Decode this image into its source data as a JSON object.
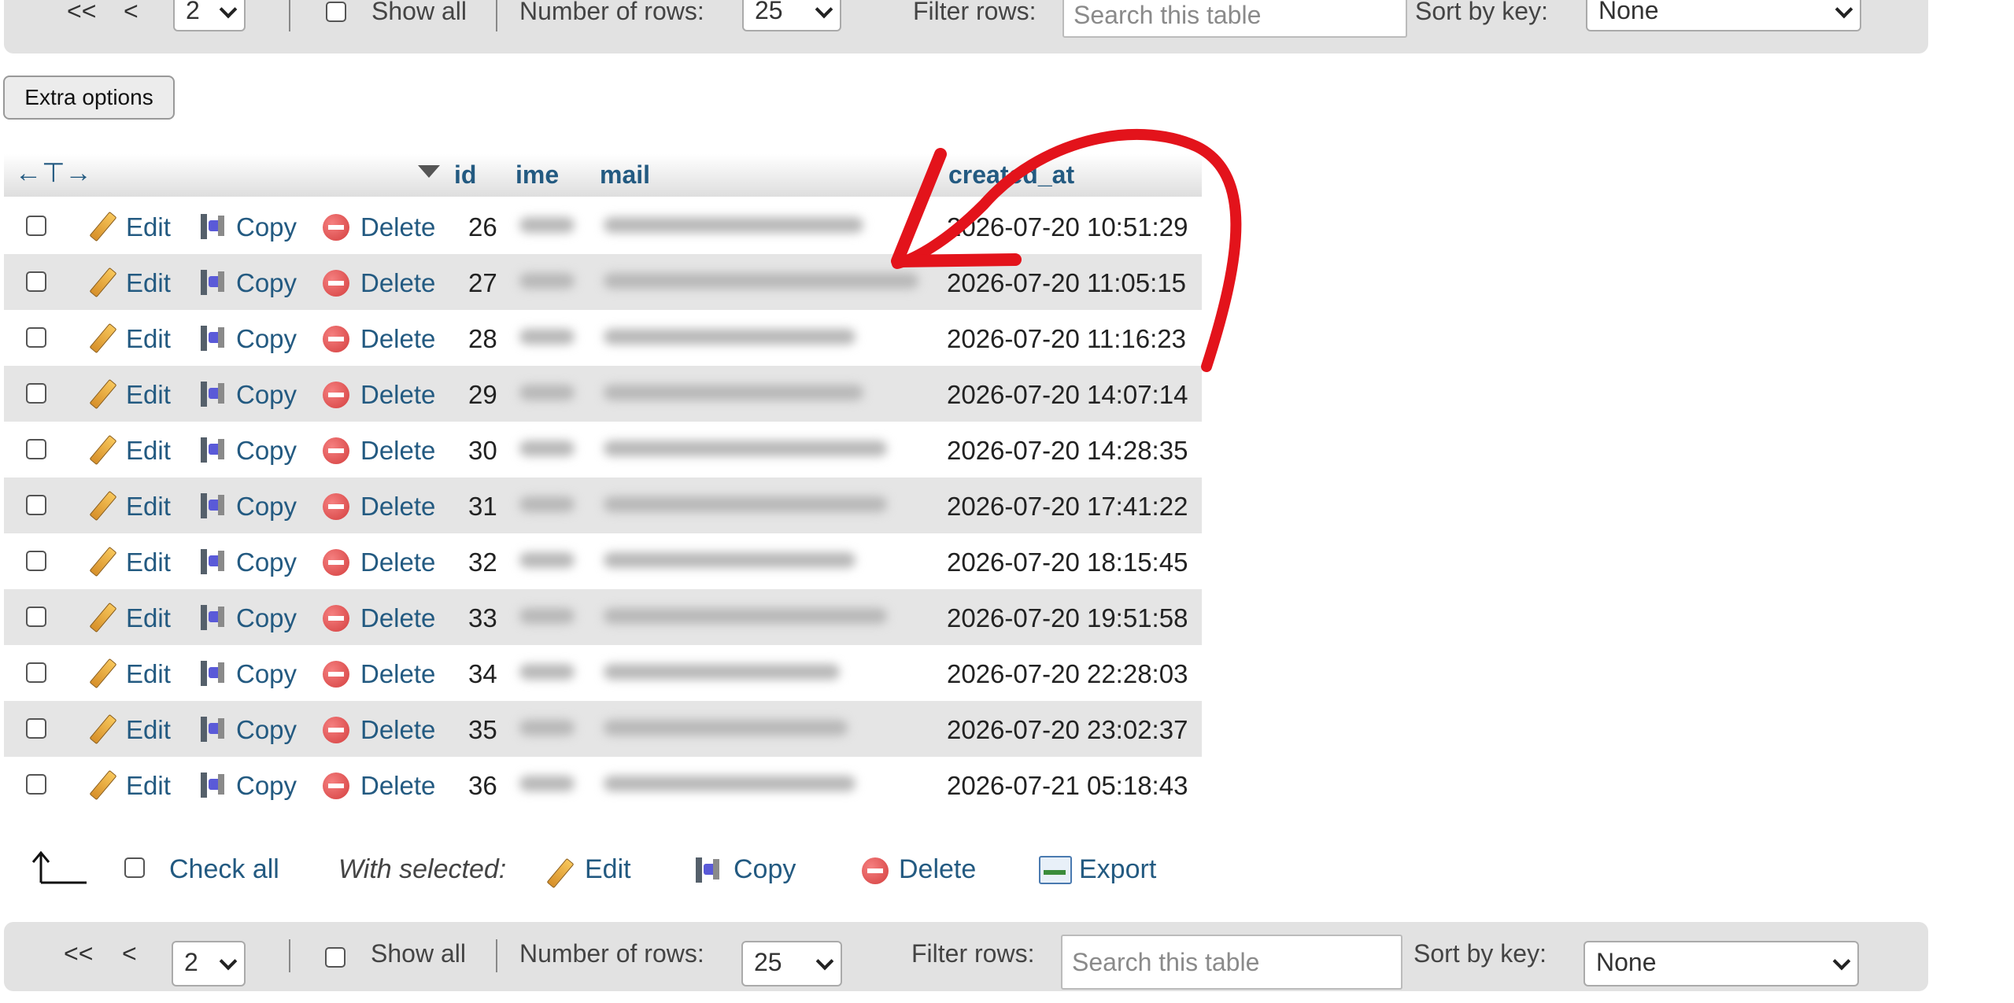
{
  "nav": {
    "first": "<<",
    "prev": "<",
    "page": "2",
    "show_all": "Show all",
    "rows_label": "Number of rows:",
    "rows_value": "25",
    "filter_label": "Filter rows:",
    "filter_placeholder": "Search this table",
    "sort_label": "Sort by key:",
    "sort_value": "None"
  },
  "extra_options": "Extra options",
  "table": {
    "columns": [
      "id",
      "ime",
      "mail",
      "created_at"
    ],
    "actions": {
      "edit": "Edit",
      "copy": "Copy",
      "delete": "Delete"
    },
    "rows": [
      {
        "id": "26",
        "created_at": "2026-07-20 10:51:29"
      },
      {
        "id": "27",
        "created_at": "2026-07-20 11:05:15"
      },
      {
        "id": "28",
        "created_at": "2026-07-20 11:16:23"
      },
      {
        "id": "29",
        "created_at": "2026-07-20 14:07:14"
      },
      {
        "id": "30",
        "created_at": "2026-07-20 14:28:35"
      },
      {
        "id": "31",
        "created_at": "2026-07-20 17:41:22"
      },
      {
        "id": "32",
        "created_at": "2026-07-20 18:15:45"
      },
      {
        "id": "33",
        "created_at": "2026-07-20 19:51:58"
      },
      {
        "id": "34",
        "created_at": "2026-07-20 22:28:03"
      },
      {
        "id": "35",
        "created_at": "2026-07-20 23:02:37"
      },
      {
        "id": "36",
        "created_at": "2026-07-21 05:18:43"
      }
    ]
  },
  "bulk": {
    "check_all": "Check all",
    "with_selected": "With selected:",
    "edit": "Edit",
    "copy": "Copy",
    "delete": "Delete",
    "export": "Export"
  },
  "colors": {
    "link": "#235a81",
    "annotation": "#e3131b",
    "row_alt": "#e5e5e5",
    "navbar": "#e2e2e2"
  }
}
